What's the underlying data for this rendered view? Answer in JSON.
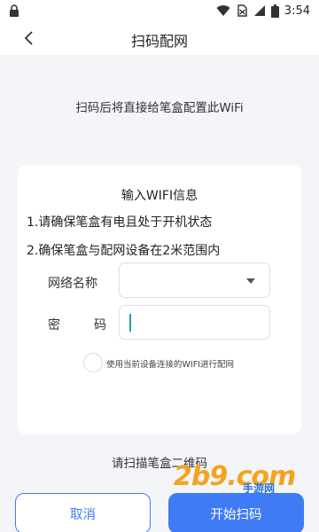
{
  "status_bar": {
    "time": "3:54"
  },
  "header": {
    "title": "扫码配网"
  },
  "intro": "扫码后将直接给笔盒配置此WiFi",
  "form": {
    "title": "输入WIFI信息",
    "tips": [
      "1.请确保笔盒有电且处于开机状态",
      "2.确保笔盒与配网设备在2米范围内"
    ],
    "ssid_label": "网络名称",
    "ssid_value": "",
    "password_label_1": "密",
    "password_label_2": "码",
    "password_value": "",
    "use_current_wifi_label": "使用当前设备连接的WIFI进行配网",
    "use_current_wifi_checked": false
  },
  "scan_hint": "请扫描笔盒二维码",
  "buttons": {
    "cancel": "取消",
    "start": "开始扫码"
  },
  "watermark": {
    "text": "2b9.com",
    "sub": "手游网"
  },
  "colors": {
    "accent": "#3f7bf5",
    "cursor": "#1ba5a7",
    "watermark": "#f5a31d"
  },
  "icons": {
    "lock": "lock-icon",
    "wifi": "wifi-icon",
    "no_sim": "no-sim-icon",
    "signal": "signal-icon",
    "battery": "battery-icon",
    "back": "back-arrow-icon",
    "dropdown": "dropdown-caret-icon"
  }
}
